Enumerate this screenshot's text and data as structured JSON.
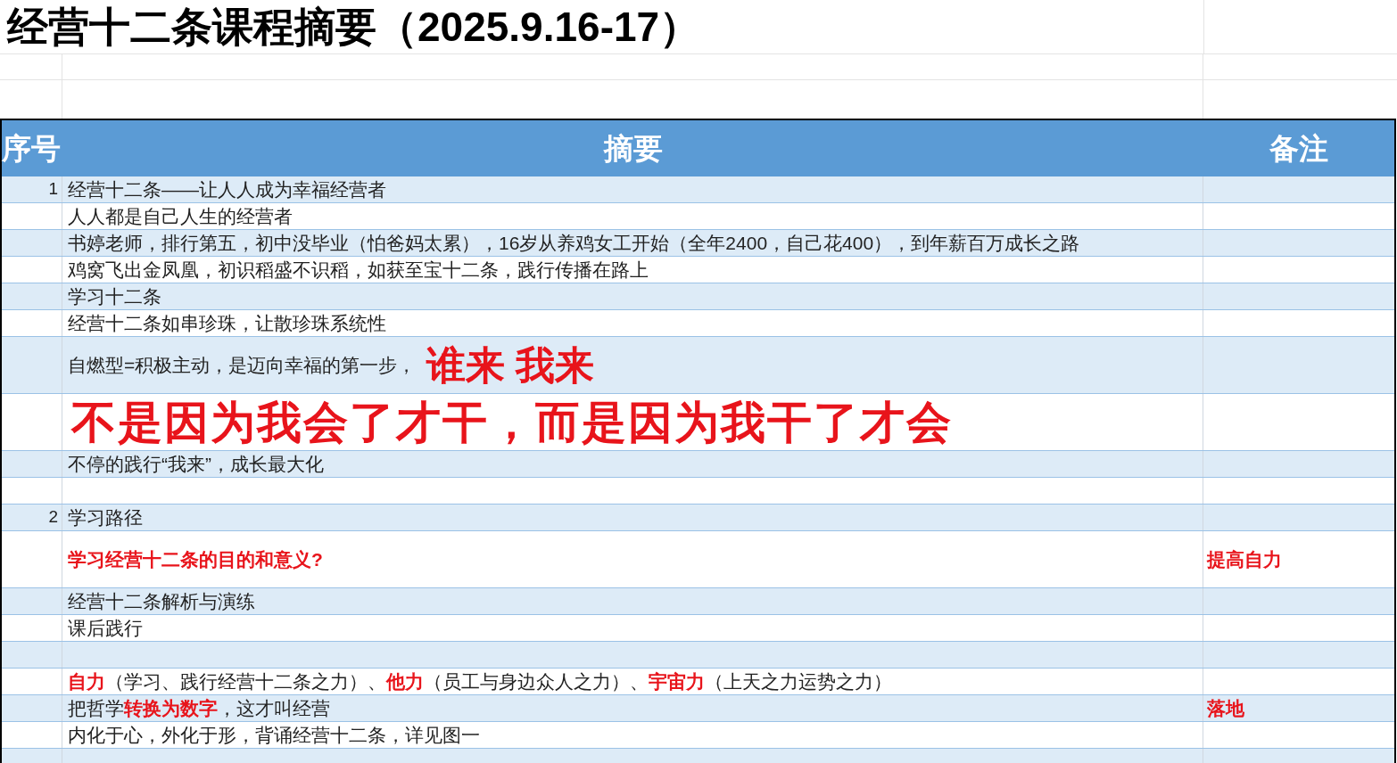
{
  "title": "经营十二条课程摘要（2025.9.16-17）",
  "header": {
    "number": "序号",
    "summary": "摘要",
    "note": "备注"
  },
  "rows": [
    {
      "number": "1",
      "kind": "normal",
      "segments": [
        {
          "text": "经营十二条——让人人成为幸福经营者",
          "kind": "plain"
        }
      ]
    },
    {
      "kind": "normal",
      "segments": [
        {
          "text": "人人都是自己人生的经营者",
          "kind": "plain"
        }
      ]
    },
    {
      "kind": "normal",
      "segments": [
        {
          "text": "书婷老师，排行第五，初中没毕业（怕爸妈太累），16岁从养鸡女工开始（全年2400，自己花400），到年薪百万成长之路",
          "kind": "plain"
        }
      ]
    },
    {
      "kind": "normal",
      "segments": [
        {
          "text": "鸡窝飞出金凤凰，初识稻盛不识稻，如获至宝十二条，践行传播在路上",
          "kind": "plain"
        }
      ]
    },
    {
      "kind": "normal",
      "segments": [
        {
          "text": "学习十二条",
          "kind": "plain"
        }
      ]
    },
    {
      "kind": "normal",
      "segments": [
        {
          "text": "经营十二条如串珍珠，让散珍珠系统性",
          "kind": "plain"
        }
      ]
    },
    {
      "kind": "tall",
      "segments": [
        {
          "text": "自燃型=积极主动，是迈向幸福的第一步，",
          "kind": "plain"
        },
        {
          "text": "谁来 我来",
          "kind": "large"
        }
      ]
    },
    {
      "kind": "tall",
      "segments": [
        {
          "text": "不是因为我会了才干，而是因为我干了才会",
          "kind": "huge"
        }
      ]
    },
    {
      "kind": "normal",
      "segments": [
        {
          "text": "不停的践行“我来”，成长最大化",
          "kind": "plain"
        }
      ]
    },
    {
      "kind": "normal",
      "segments": []
    },
    {
      "number": "2",
      "kind": "normal",
      "segments": [
        {
          "text": "学习路径",
          "kind": "plain"
        }
      ]
    },
    {
      "kind": "tall",
      "segments": [
        {
          "text": "学习经营十二条的目的和意义?",
          "kind": "red"
        }
      ],
      "note": "提高自力"
    },
    {
      "kind": "normal",
      "segments": [
        {
          "text": "经营十二条解析与演练",
          "kind": "plain"
        }
      ]
    },
    {
      "kind": "normal",
      "segments": [
        {
          "text": "课后践行",
          "kind": "plain"
        }
      ]
    },
    {
      "kind": "normal",
      "segments": []
    },
    {
      "kind": "normal",
      "segments": [
        {
          "text": "自力",
          "kind": "red"
        },
        {
          "text": "（学习、践行经营十二条之力）、",
          "kind": "plain"
        },
        {
          "text": "他力",
          "kind": "red"
        },
        {
          "text": "（员工与身边众人之力）、",
          "kind": "plain"
        },
        {
          "text": "宇宙力",
          "kind": "red"
        },
        {
          "text": "（上天之力运势之力）",
          "kind": "plain"
        }
      ]
    },
    {
      "kind": "normal",
      "segments": [
        {
          "text": "把哲学",
          "kind": "plain"
        },
        {
          "text": "转换为数字",
          "kind": "red"
        },
        {
          "text": "，这才叫经营",
          "kind": "plain"
        }
      ],
      "note": "落地"
    },
    {
      "kind": "normal",
      "segments": [
        {
          "text": "内化于心，外化于形，背诵经营十二条，详见图一",
          "kind": "plain"
        }
      ]
    },
    {
      "kind": "normal",
      "segments": []
    }
  ]
}
